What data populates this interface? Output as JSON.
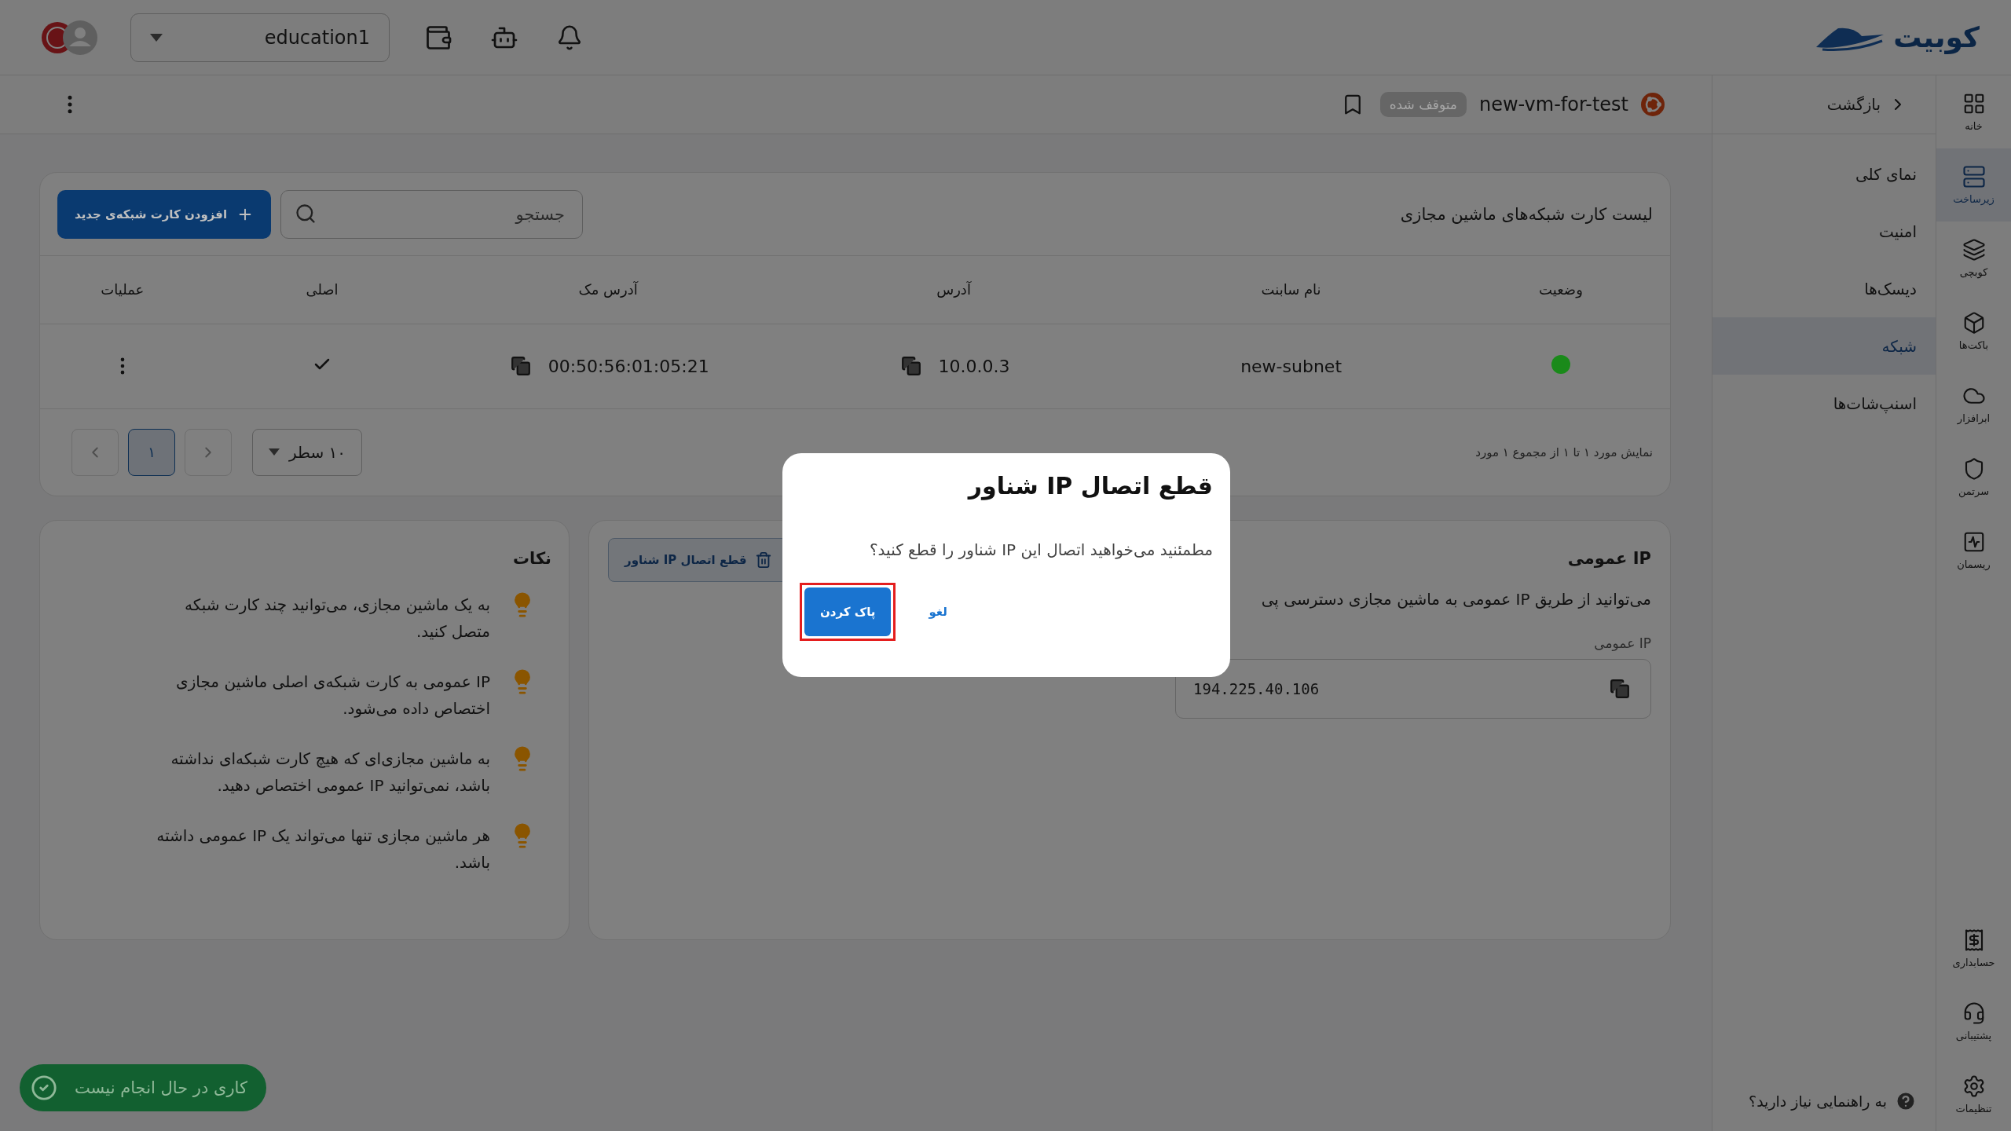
{
  "top_bar": {
    "logo": "کوبیت",
    "project_select": {
      "value": "education1"
    }
  },
  "header": {
    "back": "بازگشت",
    "vm_name": "new-vm-for-test",
    "status_badge": "متوقف شده"
  },
  "rail": [
    {
      "label": "خانه",
      "selected": false
    },
    {
      "label": "زیرساخت",
      "selected": true
    },
    {
      "label": "کوبچی",
      "selected": false
    },
    {
      "label": "باکت‌ها",
      "selected": false
    },
    {
      "label": "ابرافزار",
      "selected": false
    },
    {
      "label": "سرتمن",
      "selected": false
    },
    {
      "label": "ریسمان",
      "selected": false
    }
  ],
  "rail_bottom": [
    {
      "label": "حسابداری",
      "selected": false
    },
    {
      "label": "پشتیبانی",
      "selected": false
    },
    {
      "label": "تنظیمات",
      "selected": false
    }
  ],
  "section_nav": [
    {
      "label": "نمای کلی",
      "selected": false
    },
    {
      "label": "امنیت",
      "selected": false
    },
    {
      "label": "دیسک‌ها",
      "selected": false
    },
    {
      "label": "شبکه",
      "selected": true
    },
    {
      "label": "اسنپ‌شات‌ها",
      "selected": false
    }
  ],
  "help": "به راهنمایی نیاز دارید؟",
  "nic_card": {
    "title": "لیست کارت شبکه‌های ماشین مجازی",
    "search": {
      "placeholder": "جستجو"
    },
    "add_button": "افزودن کارت شبکه‌ی جدید",
    "columns": [
      "وضعیت",
      "نام سابنت",
      "آدرس",
      "آدرس مک",
      "اصلی",
      "عملیات"
    ],
    "rows": [
      {
        "color": "#1a8a1a",
        "subnet": "new-subnet",
        "address": "10.0.0.3",
        "mac": "00:50:56:01:05:21",
        "primary": true
      }
    ],
    "pagination": {
      "summary": "نمایش مورد ۱ تا ۱ از مجموع ۱ مورد",
      "rows_per_page": "۱۰ سطر",
      "pages": [
        {
          "label": "۱",
          "selected": true
        }
      ]
    }
  },
  "public_ip_card": {
    "title": "IP عمومی",
    "description": "می‌توانید از طریق IP عمومی به ماشین مجازی دسترسی پی",
    "field_label": "IP عمومی",
    "value": "194.225.40.106",
    "disconnect_button": "قطع اتصال IP شناور"
  },
  "notes_card": {
    "title": "نکات",
    "items": [
      "به یک ماشین مجازی، می‌توانید چند کارت شبکه متصل کنید.",
      "IP عمومی به کارت شبکه‌ی اصلی ماشین مجازی اختصاص داده می‌شود.",
      "به ماشین مجازی‌ای که هیچ کارت شبکه‌ای نداشته باشد، نمی‌توانید IP عمومی اختصاص دهید.",
      "هر ماشین مجازی تنها می‌تواند یک IP عمومی داشته باشد."
    ]
  },
  "toast": "کاری در حال انجام نیست",
  "dialog": {
    "title": "قطع اتصال IP شناور",
    "message": "مطمئنید می‌خواهید اتصال این IP شناور را قطع کنید؟",
    "confirm": "پاک کردن",
    "cancel": "لغو",
    "confirm_highlighted": true
  }
}
